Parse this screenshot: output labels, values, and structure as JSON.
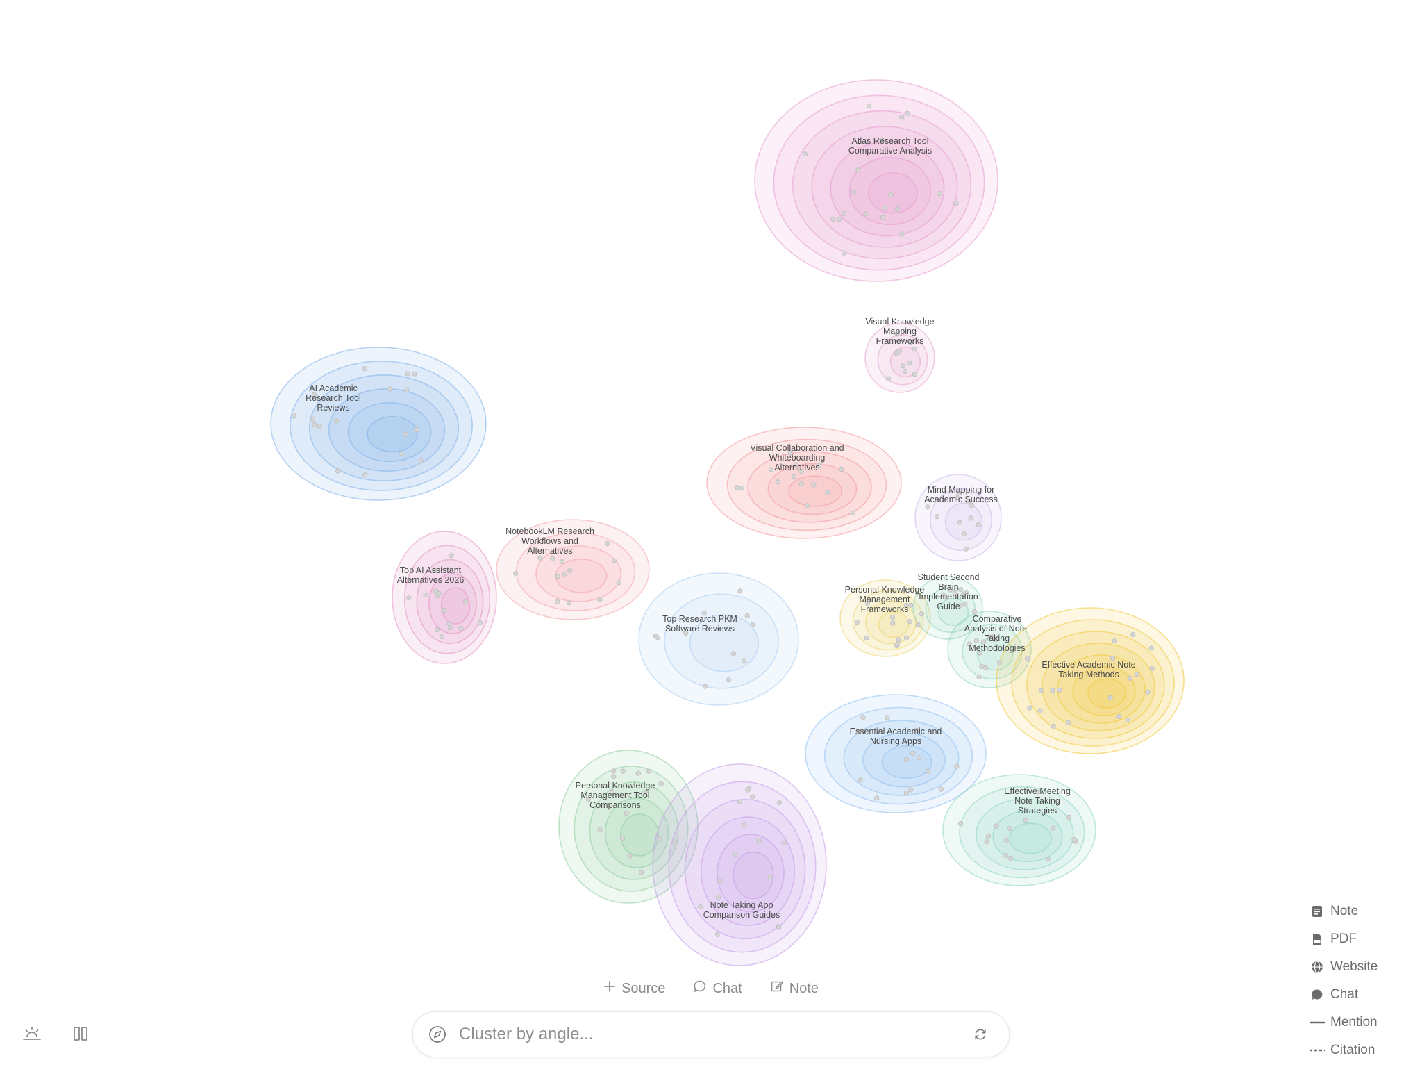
{
  "clusters": [
    {
      "label": "Atlas Research Tool Comparative Analysis",
      "color": "#e79bd0"
    },
    {
      "label": "Visual Knowledge Mapping Frameworks",
      "color": "#e6a6cf"
    },
    {
      "label": "AI Academic Research Tool Reviews",
      "color": "#7fb0ea"
    },
    {
      "label": "Top AI Assistant Alternatives 2026",
      "color": "#e291c2"
    },
    {
      "label": "NotebookLM Research Workflows and Alternatives",
      "color": "#f3a4aa"
    },
    {
      "label": "Visual Collaboration and Whiteboarding Alternatives",
      "color": "#f3999e"
    },
    {
      "label": "Mind Mapping for Academic Success",
      "color": "#cbb8e8"
    },
    {
      "label": "Top Research PKM Software Reviews",
      "color": "#a9cdf2"
    },
    {
      "label": "Personal Knowledge Management Frameworks",
      "color": "#edd36f"
    },
    {
      "label": "Student Second Brain Implementation Guide",
      "color": "#8fd4be"
    },
    {
      "label": "Comparative Analysis of Note-Taking Methodologies",
      "color": "#8fd4be"
    },
    {
      "label": "Effective Academic Note Taking Methods",
      "color": "#f0c838"
    },
    {
      "label": "Essential Academic and Nursing Apps",
      "color": "#8fbff0"
    },
    {
      "label": "Personal Knowledge Management Tool Comparisons",
      "color": "#8ccc9e"
    },
    {
      "label": "Effective Meeting Note Taking Strategies",
      "color": "#8cd6c2"
    },
    {
      "label": "Note Taking App Comparison Guides",
      "color": "#c59ae8"
    }
  ],
  "legend": {
    "note": "Note",
    "pdf": "PDF",
    "website": "Website",
    "chat": "Chat",
    "mention": "Mention",
    "citation": "Citation"
  },
  "actions": {
    "source": "Source",
    "chat": "Chat",
    "note": "Note"
  },
  "search": {
    "placeholder": "Cluster by angle..."
  },
  "icons": [
    "sunrise-icon",
    "columns-icon",
    "compass-icon",
    "refresh-icon",
    "plus-icon",
    "chat-bubble-icon",
    "edit-icon",
    "note-icon",
    "pdf-icon",
    "globe-icon",
    "line-icon",
    "dashed-line-icon"
  ]
}
